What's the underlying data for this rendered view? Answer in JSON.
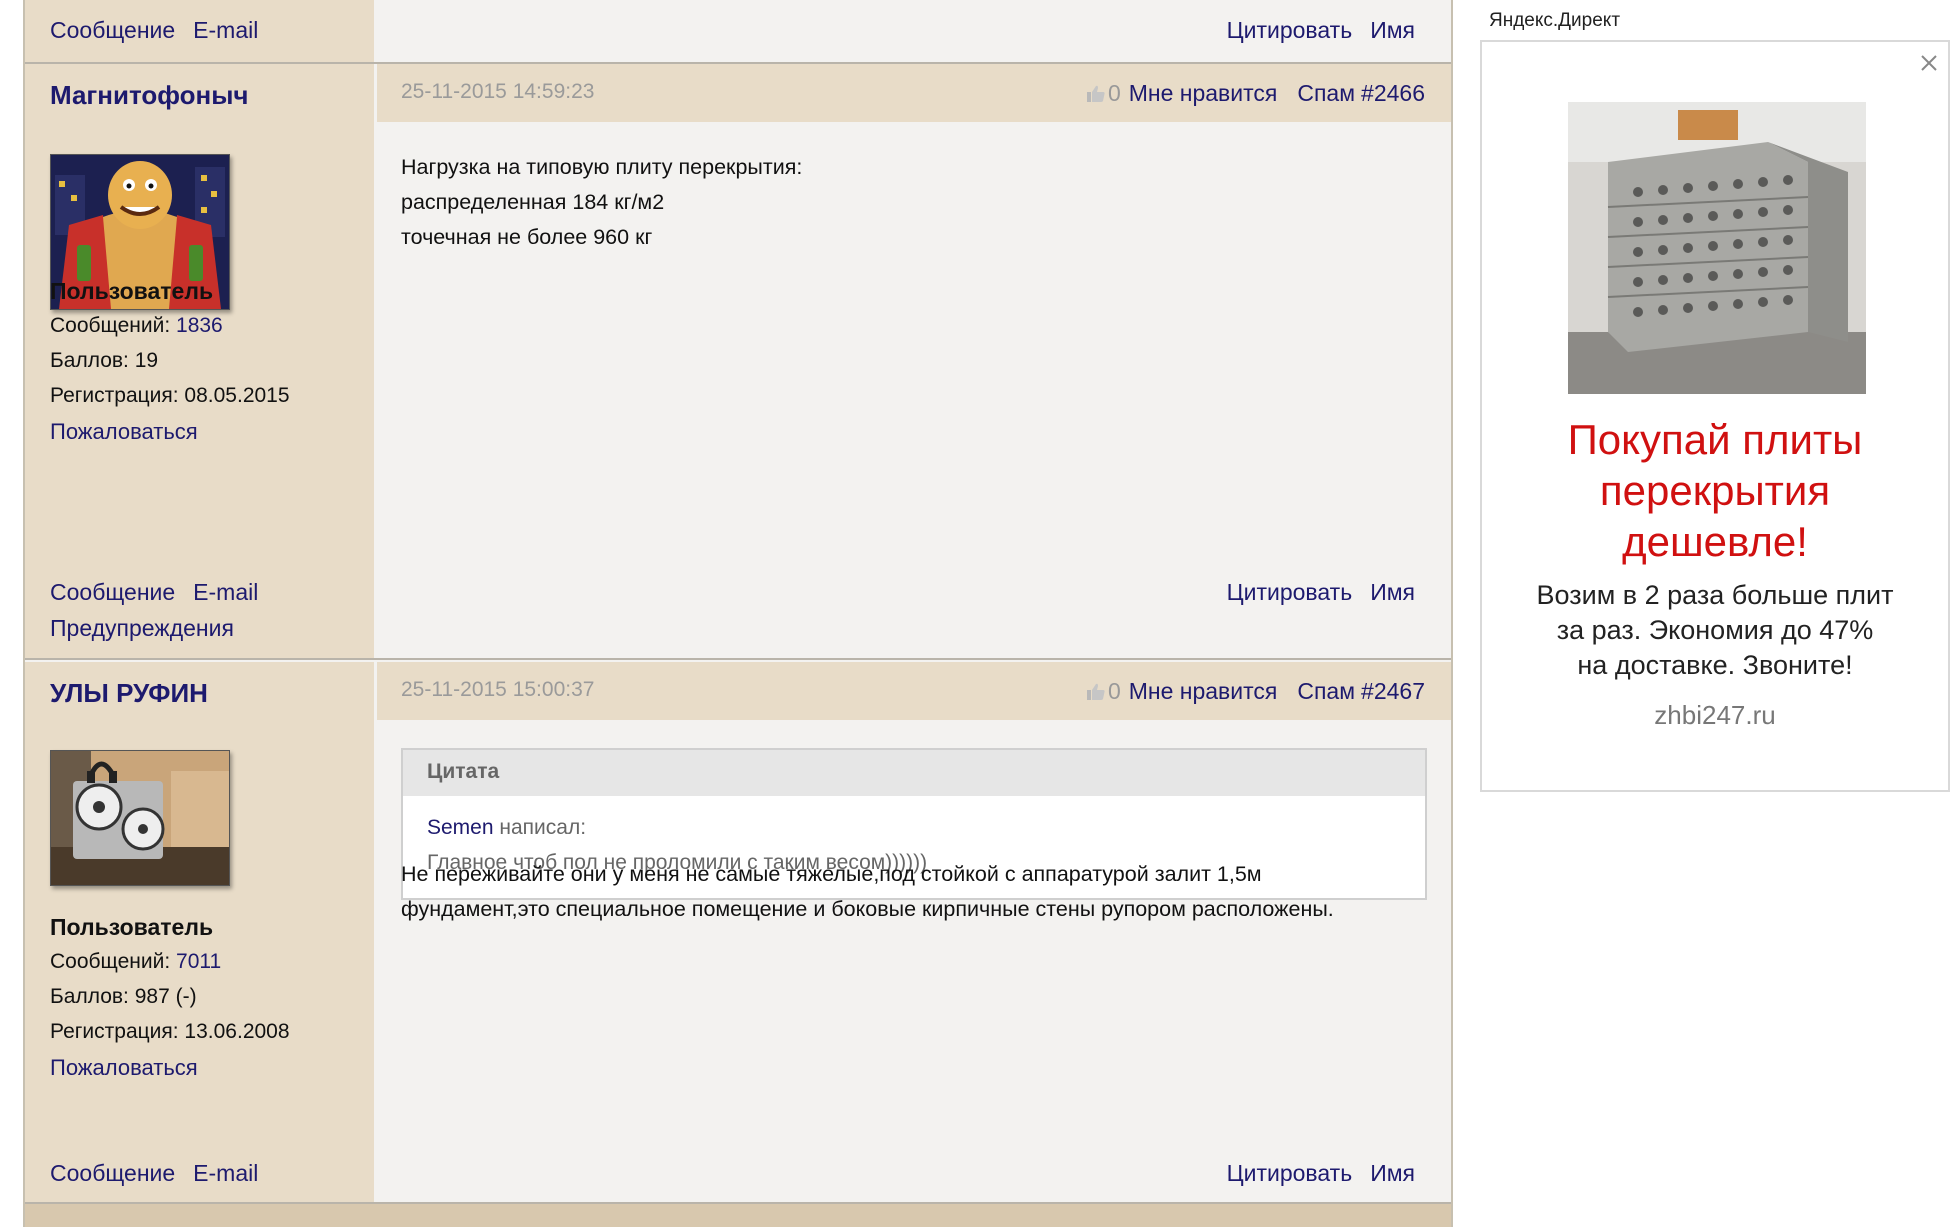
{
  "prev_post_footer": {
    "message": "Сообщение",
    "email": "E-mail",
    "quote": "Цитировать",
    "name": "Имя"
  },
  "posts": [
    {
      "author": "Магнитофоныч",
      "role": "Пользователь",
      "messages_label": "Сообщений:",
      "messages_value": "1836",
      "points_text": "Баллов: 19",
      "registration_text": "Регистрация: 08.05.2015",
      "report": "Пожаловаться",
      "date": "25-11-2015 14:59:23",
      "like_count": "0",
      "like_label": "Мне нравится",
      "spam_label": "Спам",
      "post_number": "#2466",
      "body": [
        "Нагрузка на типовую плиту перекрытия:",
        "распределенная 184 кг/м2",
        "точечная не более 960 кг"
      ],
      "footer_message": "Сообщение",
      "footer_email": "E-mail",
      "footer_warnings": "Предупреждения",
      "footer_quote": "Цитировать",
      "footer_name": "Имя"
    },
    {
      "author": "УЛЫ РУФИН",
      "role": "Пользователь",
      "messages_label": "Сообщений:",
      "messages_value": "7011",
      "points_text": "Баллов: 987 (-)",
      "registration_text": "Регистрация: 13.06.2008",
      "report": "Пожаловаться",
      "date": "25-11-2015 15:00:37",
      "like_count": "0",
      "like_label": "Мне нравится",
      "spam_label": "Спам",
      "post_number": "#2467",
      "quote": {
        "title": "Цитата",
        "author": "Semen",
        "wrote": "написал:",
        "text": "Главное чтоб пол не проломили с таким весом))))))"
      },
      "body": [
        "Не переживайте они у меня не самые тяжелые,под стойкой с аппаратурой залит 1,5м",
        "фундамент,это специальное помещение и боковые кирпичные стены рупором расположены."
      ],
      "footer_message": "Сообщение",
      "footer_email": "E-mail",
      "footer_quote": "Цитировать",
      "footer_name": "Имя"
    }
  ],
  "ad": {
    "label": "Яндекс.Директ",
    "close_icon": "close-icon",
    "title_lines": [
      "Покупай плиты",
      "перекрытия",
      "дешевле!"
    ],
    "text_lines": [
      "Возим в 2 раза больше плит",
      "за раз. Экономия до 47%",
      "на доставке. Звоните!"
    ],
    "domain": "zhbi247.ru"
  },
  "colors": {
    "link": "#1d1a6e",
    "sidebar_bg": "#e8dcc8",
    "post_bg": "#f3f2f0",
    "ad_title": "#d01010"
  }
}
